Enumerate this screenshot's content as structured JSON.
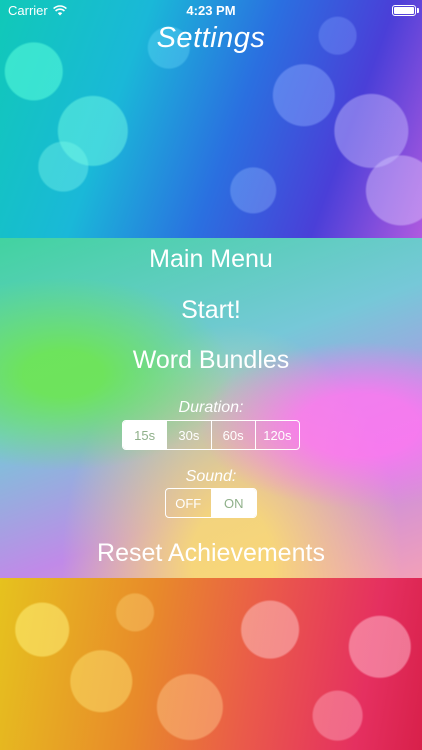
{
  "status_bar": {
    "carrier": "Carrier",
    "time": "4:23 PM",
    "battery_level": 1.0
  },
  "header": {
    "title": "Settings"
  },
  "menu": {
    "main_menu": "Main Menu",
    "start": "Start!",
    "word_bundles": "Word Bundles",
    "reset_achievements": "Reset Achievements"
  },
  "duration": {
    "label": "Duration:",
    "options": [
      "15s",
      "30s",
      "60s",
      "120s"
    ],
    "selected": "15s"
  },
  "sound": {
    "label": "Sound:",
    "options": [
      "OFF",
      "ON"
    ],
    "selected": "ON"
  },
  "colors": {
    "text": "#ffffff",
    "selected_segment_bg": "#ffffff"
  }
}
